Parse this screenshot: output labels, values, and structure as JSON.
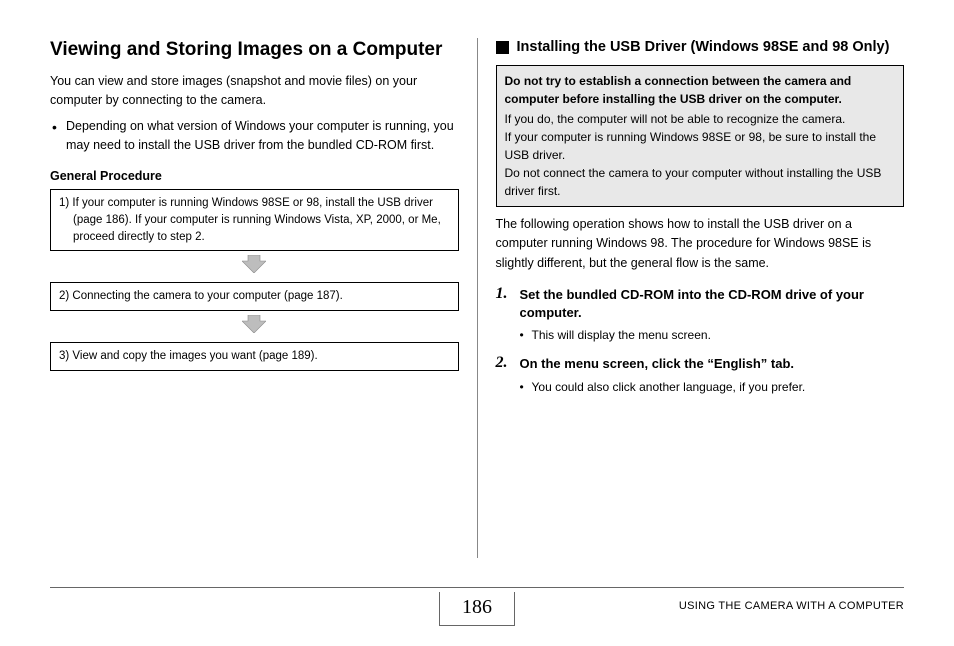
{
  "left": {
    "title": "Viewing and Storing Images on a Computer",
    "intro": "You can view and store images (snapshot and movie files) on your computer by connecting to the camera.",
    "bullet1": "Depending on what version of Windows your computer is running, you may need to install the USB driver from the bundled CD-ROM first.",
    "subhead": "General Procedure",
    "step1": "1) If your computer is running Windows 98SE or 98, install the USB driver (page 186). If your computer is running Windows Vista, XP, 2000, or Me, proceed directly to step 2.",
    "step2": "2) Connecting the camera to your computer (page 187).",
    "step3": "3) View and copy the images you want (page 189)."
  },
  "right": {
    "sect_title": "Installing the USB Driver (Windows 98SE and 98 Only)",
    "warn_strong": "Do not try to establish a connection between the camera and computer before installing the USB driver on the computer.",
    "warn_p1": "If you do, the computer will not be able to recognize the camera.",
    "warn_p2": "If your computer is running Windows 98SE or 98, be sure to install the USB driver.",
    "warn_p3": "Do not connect the camera to your computer without installing the USB driver first.",
    "followup": "The following operation shows how to install the USB driver on a computer running Windows 98. The procedure for Windows 98SE is slightly different, but the general flow is the same.",
    "s1n": "1.",
    "s1t": "Set the bundled CD-ROM into the CD-ROM drive of your computer.",
    "s1b": "This will display the menu screen.",
    "s2n": "2.",
    "s2t": "On the menu screen, click the “English” tab.",
    "s2b": "You could also click another language, if you prefer."
  },
  "footer": {
    "page": "186",
    "label": "USING THE CAMERA WITH A COMPUTER"
  }
}
